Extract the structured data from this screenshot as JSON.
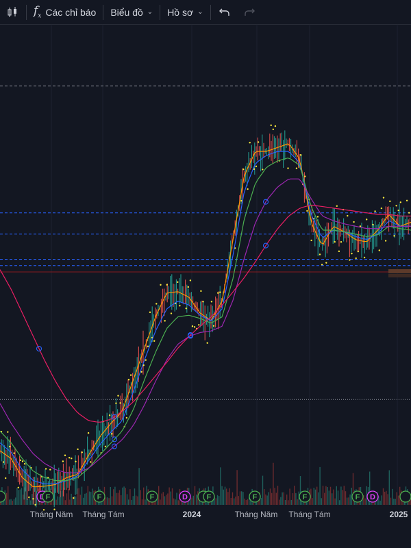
{
  "toolbar": {
    "indicators_label": "Các chỉ báo",
    "chart_type_label": "Biểu đồ",
    "profile_label": "Hồ sơ",
    "icons": [
      "candlestick-icon",
      "fx-icon",
      "chevron-down-icon",
      "undo-icon",
      "redo-icon"
    ]
  },
  "colors": {
    "background": "#131722",
    "candle_up": "#26a69a",
    "candle_down": "#ef5350",
    "ma_orange": "#ff9800",
    "ma_blue": "#2962ff",
    "ma_green": "#4caf50",
    "ma_purple": "#9c27b0",
    "ma_crimson": "#e91e63",
    "dots": "#ffeb3b",
    "hline_blue": "#2962ff",
    "hline_gray": "#9598a1",
    "event_green": "#4caf50",
    "event_pink": "#e040fb"
  },
  "chart_data": {
    "type": "line",
    "x_tick_labels": [
      "Tháng Năm",
      "Tháng Tám",
      "2024",
      "Tháng Năm",
      "Tháng Tám",
      "2025"
    ],
    "major_tick_labels": [
      "2024",
      "2025"
    ],
    "y_axis": "hidden",
    "series": [
      {
        "color": "#ff9800",
        "values": [
          60,
          50,
          26,
          14,
          15,
          17,
          26,
          30,
          55,
          78,
          95,
          110,
          150,
          190,
          230,
          260,
          262,
          255,
          235,
          225,
          250,
          330,
          410,
          440,
          440,
          445,
          450,
          430,
          350,
          320,
          345,
          338,
          328,
          325,
          340,
          360,
          345,
          350
        ]
      },
      {
        "color": "#2962ff",
        "values": [
          70,
          58,
          36,
          22,
          18,
          18,
          22,
          28,
          48,
          68,
          84,
          98,
          135,
          175,
          212,
          240,
          250,
          245,
          232,
          225,
          240,
          310,
          390,
          425,
          435,
          440,
          440,
          425,
          360,
          330,
          340,
          338,
          332,
          328,
          335,
          352,
          345,
          345
        ]
      },
      {
        "color": "#4caf50",
        "values": [
          85,
          70,
          50,
          34,
          26,
          22,
          22,
          26,
          38,
          55,
          70,
          85,
          112,
          150,
          185,
          215,
          230,
          232,
          228,
          222,
          230,
          280,
          355,
          400,
          420,
          428,
          432,
          422,
          370,
          340,
          340,
          338,
          335,
          332,
          334,
          345,
          342,
          340
        ]
      },
      {
        "color": "#9c27b0",
        "values": [
          120,
          95,
          74,
          56,
          44,
          36,
          32,
          32,
          38,
          50,
          62,
          74,
          92,
          118,
          148,
          175,
          195,
          205,
          210,
          212,
          218,
          252,
          305,
          350,
          378,
          395,
          405,
          405,
          380,
          358,
          352,
          348,
          345,
          342,
          342,
          345,
          345,
          345
        ]
      },
      {
        "color": "#e91e63",
        "values": [
          290,
          265,
          235,
          205,
          175,
          148,
          125,
          108,
          98,
          96,
          100,
          110,
          122,
          138,
          155,
          172,
          190,
          205,
          218,
          230,
          245,
          262,
          280,
          300,
          322,
          342,
          358,
          368,
          372,
          370,
          368,
          366,
          364,
          362,
          360,
          360,
          358,
          358
        ]
      }
    ],
    "horizontal_lines": [
      {
        "value": 523,
        "style": "dashed",
        "color": "#9598a1"
      },
      {
        "value": 362,
        "style": "dashed",
        "color": "#2962ff"
      },
      {
        "value": 335,
        "style": "dashed",
        "color": "#2962ff"
      },
      {
        "value": 303,
        "style": "dashed",
        "color": "#2962ff"
      },
      {
        "value": 295,
        "style": "dashed",
        "color": "#2962ff"
      },
      {
        "value": 287,
        "style": "solid",
        "color": "#b71c1c"
      },
      {
        "value": 125,
        "style": "dotted",
        "color": "#9598a1"
      }
    ],
    "events": [
      {
        "label": "",
        "color": "#4caf50"
      },
      {
        "label": "D",
        "color": "#e040fb"
      },
      {
        "label": "F",
        "color": "#4caf50"
      },
      {
        "label": "F",
        "color": "#4caf50"
      },
      {
        "label": "F",
        "color": "#4caf50"
      },
      {
        "label": "D",
        "color": "#e040fb"
      },
      {
        "label": "",
        "color": "#4caf50"
      },
      {
        "label": "F",
        "color": "#4caf50"
      },
      {
        "label": "F",
        "color": "#4caf50"
      },
      {
        "label": "F",
        "color": "#4caf50"
      },
      {
        "label": "F",
        "color": "#4caf50"
      },
      {
        "label": "D",
        "color": "#e040fb"
      },
      {
        "label": "",
        "color": "#4caf50"
      }
    ]
  }
}
